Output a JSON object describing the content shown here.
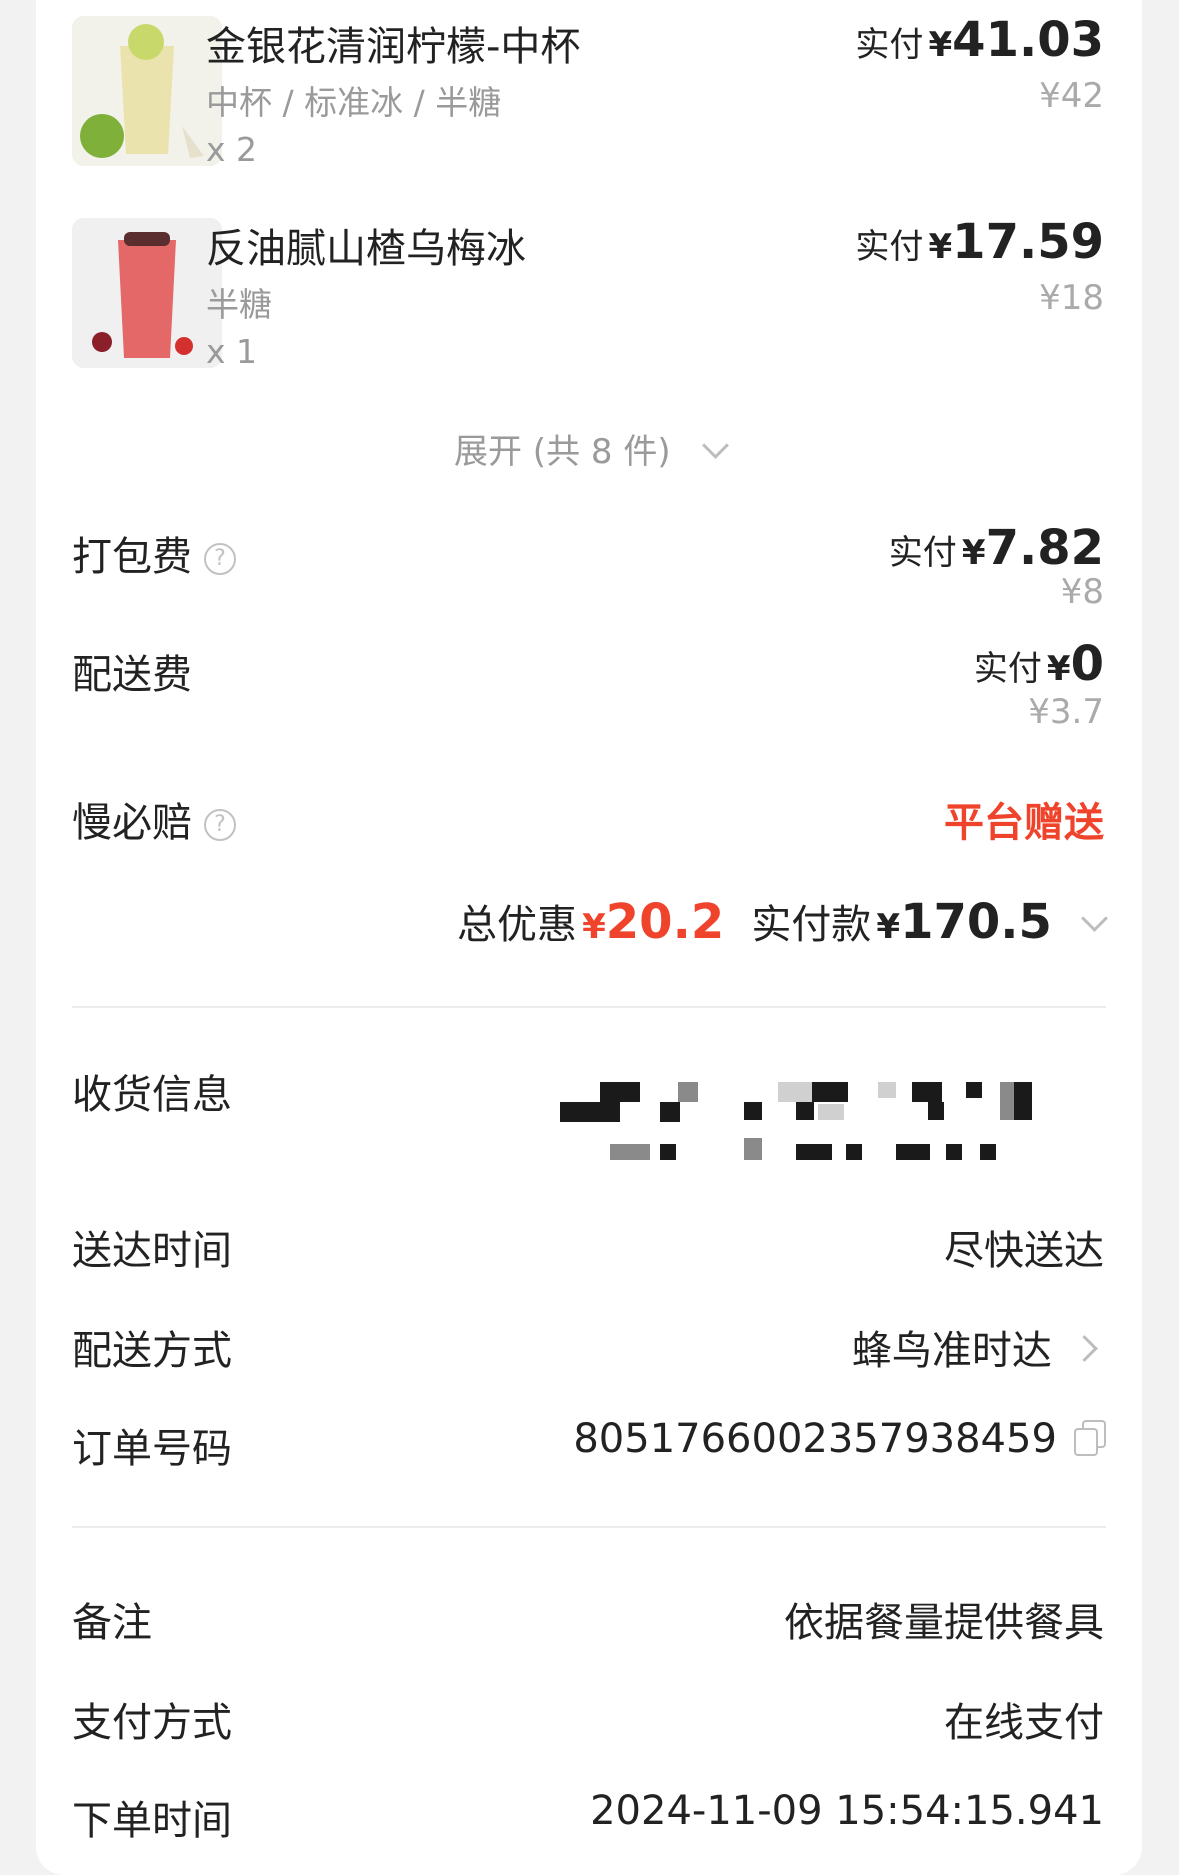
{
  "colors": {
    "accent_red": "#f0432b",
    "muted_text": "#9a9a9a",
    "divider": "#ececec"
  },
  "products": [
    {
      "name": "金银花清润柠檬-中杯",
      "spec": "中杯 / 标准冰 / 半糖",
      "qty": "x 2",
      "paid_label": "实付",
      "paid_currency": "¥",
      "paid_amount": "41.03",
      "original_price": "¥42",
      "thumb_colors": [
        "#f1f1e4",
        "#e9e4b4"
      ]
    },
    {
      "name": "反油腻山楂乌梅冰",
      "spec": "半糖",
      "qty": "x 1",
      "paid_label": "实付",
      "paid_currency": "¥",
      "paid_amount": "17.59",
      "original_price": "¥18",
      "thumb_colors": [
        "#f0f0f0",
        "#e25a5a"
      ]
    }
  ],
  "expand": {
    "label": "展开 (共 8 件)",
    "icon": "chevron-down-icon"
  },
  "fees": {
    "packing": {
      "label": "打包费",
      "help_icon": "question-circle-icon",
      "paid_label": "实付",
      "paid_currency": "¥",
      "paid_amount": "7.82",
      "original_price": "¥8"
    },
    "delivery": {
      "label": "配送费",
      "paid_label": "实付",
      "paid_currency": "¥",
      "paid_amount": "0",
      "original_price": "¥3.7"
    },
    "slow_compensation": {
      "label": "慢必赔",
      "help_icon": "question-circle-icon",
      "value": "平台赠送"
    }
  },
  "summary": {
    "discount_label": "总优惠",
    "discount_currency": "¥",
    "discount_amount": "20.2",
    "paid_label": "实付款",
    "paid_currency": "¥",
    "paid_amount": "170.5"
  },
  "receiver": {
    "label": "收货信息"
  },
  "delivery_time": {
    "label": "送达时间",
    "value": "尽快送达"
  },
  "delivery_method": {
    "label": "配送方式",
    "value": "蜂鸟准时达",
    "icon": "chevron-right-icon"
  },
  "order_number": {
    "label": "订单号码",
    "value": "8051766002357938459",
    "icon": "copy-icon"
  },
  "remark": {
    "label": "备注",
    "value": "依据餐量提供餐具"
  },
  "payment_method": {
    "label": "支付方式",
    "value": "在线支付"
  },
  "order_time": {
    "label": "下单时间",
    "value": "2024-11-09 15:54:15.941"
  }
}
